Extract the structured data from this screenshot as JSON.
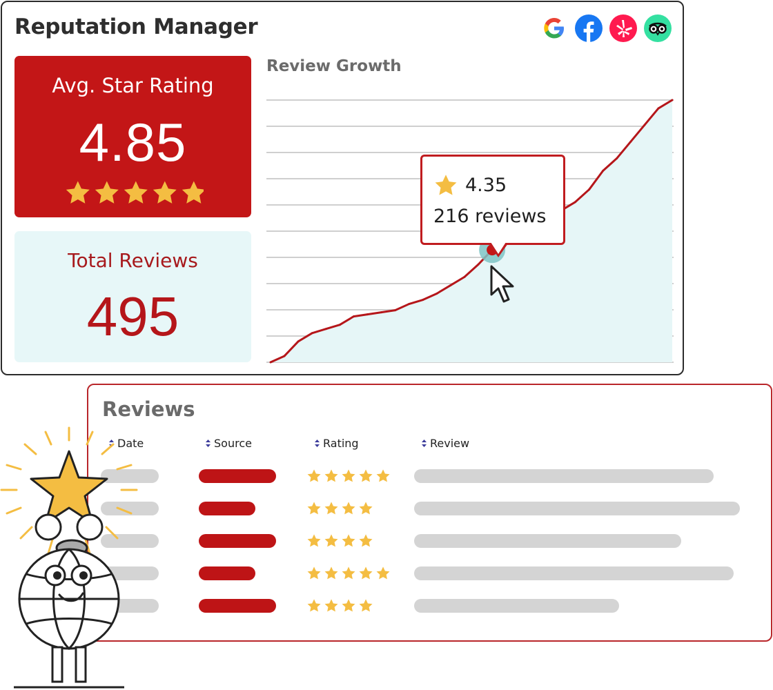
{
  "app": {
    "title": "Reputation Manager"
  },
  "sources": [
    {
      "name": "Google",
      "icon": "google-icon"
    },
    {
      "name": "Facebook",
      "icon": "facebook-icon"
    },
    {
      "name": "Yelp",
      "icon": "yelp-icon"
    },
    {
      "name": "Tripadvisor",
      "icon": "tripadvisor-icon"
    }
  ],
  "avg_rating": {
    "label": "Avg. Star Rating",
    "value": "4.85",
    "stars": 4.85
  },
  "total_reviews": {
    "label": "Total Reviews",
    "value": "495"
  },
  "colors": {
    "brand_red": "#c31617",
    "light_teal": "#e7f7f8",
    "star_gold": "#f4bd42",
    "placeholder_grey": "#d4d4d4"
  },
  "chart_data": {
    "type": "area",
    "title": "Review Growth",
    "xlabel": "",
    "ylabel": "",
    "grid": true,
    "x": [
      0,
      1,
      2,
      3,
      4,
      5,
      6,
      7,
      8,
      9,
      10,
      11,
      12,
      13,
      14,
      15,
      16,
      17,
      18,
      19,
      20,
      21,
      22,
      23,
      24,
      25,
      26,
      27,
      28,
      29
    ],
    "series": [
      {
        "values": [
          0,
          3,
          10,
          14,
          16,
          18,
          22,
          23,
          24,
          25,
          28,
          30,
          33,
          37,
          41,
          47,
          54,
          60,
          64,
          67,
          70,
          73,
          77,
          83,
          92,
          98,
          106,
          114,
          122,
          126
        ]
      }
    ],
    "ylim": [
      0,
      126
    ],
    "highlight": {
      "index": 16,
      "rating": "4.35",
      "reviews": "216 reviews"
    }
  },
  "reviews": {
    "title": "Reviews",
    "columns": [
      "Date",
      "Source",
      "Rating",
      "Review"
    ],
    "rows": [
      {
        "date_len": 0.5,
        "source_len": 1.0,
        "rating": 5,
        "review_len": 0.92
      },
      {
        "date_len": 0.5,
        "source_len": 0.73,
        "rating": 4,
        "review_len": 1.0
      },
      {
        "date_len": 0.5,
        "source_len": 1.0,
        "rating": 4,
        "review_len": 0.82
      },
      {
        "date_len": 0.5,
        "source_len": 0.73,
        "rating": 5,
        "review_len": 0.98
      },
      {
        "date_len": 0.5,
        "source_len": 1.0,
        "rating": 4,
        "review_len": 0.63
      }
    ]
  }
}
